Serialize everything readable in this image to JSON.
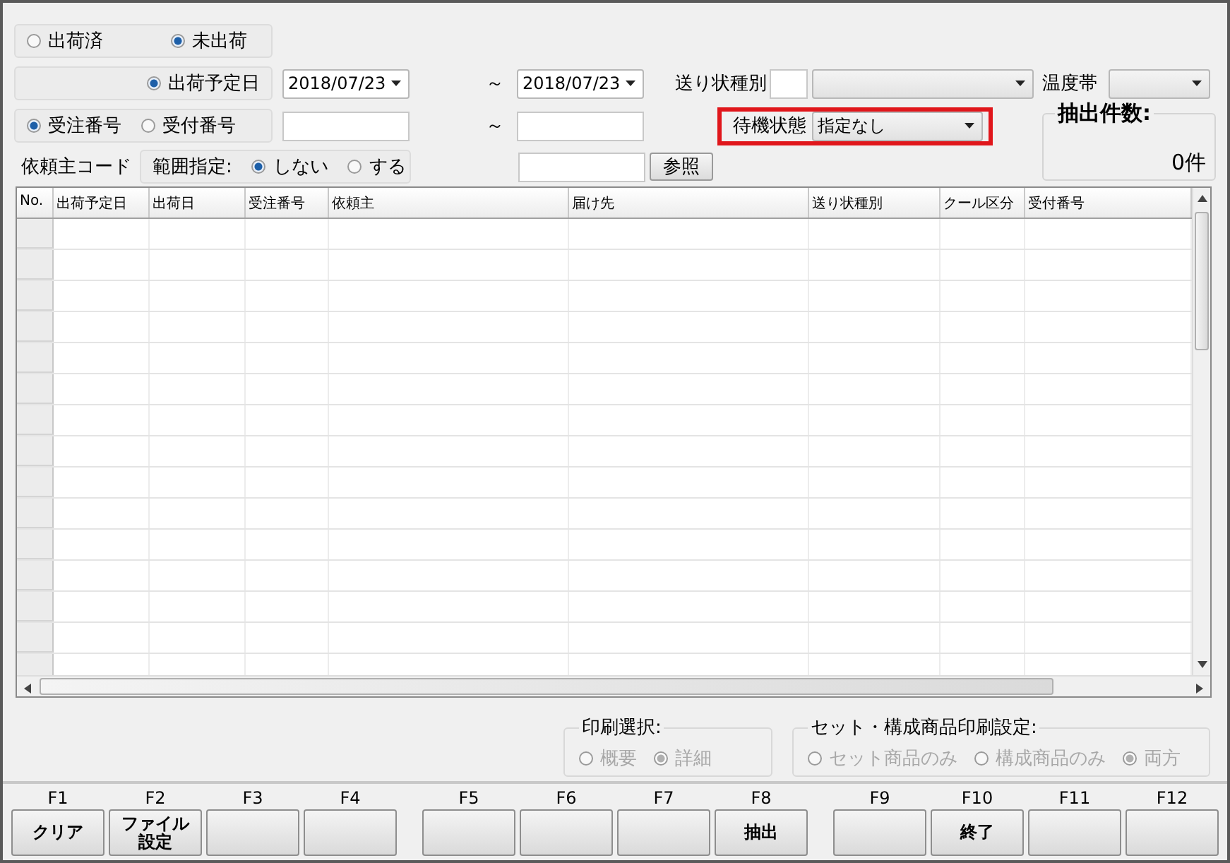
{
  "shipment_status": [
    {
      "label": "出荷済",
      "selected": false
    },
    {
      "label": "未出荷",
      "selected": true
    }
  ],
  "date_filter": {
    "label": "出荷予定日",
    "selected": true,
    "from": "2018/07/23",
    "tilde": "～",
    "to": "2018/07/23"
  },
  "number_filter": {
    "options": [
      {
        "label": "受注番号",
        "selected": true
      },
      {
        "label": "受付番号",
        "selected": false
      }
    ],
    "tilde": "～"
  },
  "invoice_type": {
    "label": "送り状種別"
  },
  "temperature": {
    "label": "温度帯"
  },
  "waiting_state": {
    "label": "待機状態",
    "value": "指定なし",
    "highlighted": true
  },
  "client_code": {
    "label": "依頼主コード",
    "range_label": "範囲指定:",
    "options": [
      {
        "label": "しない",
        "selected": true
      },
      {
        "label": "する",
        "selected": false
      }
    ],
    "browse_button": "参照"
  },
  "count": {
    "title": "抽出件数:",
    "value": "0件"
  },
  "table": {
    "columns": [
      "No.",
      "出荷予定日",
      "出荷日",
      "受注番号",
      "依頼主",
      "届け先",
      "送り状種別",
      "クール区分",
      "受付番号"
    ]
  },
  "print_selection": {
    "title": "印刷選択:",
    "disabled": true,
    "options": [
      {
        "label": "概要",
        "selected": false
      },
      {
        "label": "詳細",
        "selected": true
      }
    ]
  },
  "set_print": {
    "title": "セット・構成商品印刷設定:",
    "disabled": true,
    "options": [
      {
        "label": "セット商品のみ",
        "selected": false
      },
      {
        "label": "構成商品のみ",
        "selected": false
      },
      {
        "label": "両方",
        "selected": true
      }
    ]
  },
  "function_keys": [
    {
      "key": "F1",
      "label": "クリア"
    },
    {
      "key": "F2",
      "lines": [
        "ファイル",
        "設定"
      ]
    },
    {
      "key": "F3"
    },
    {
      "key": "F4"
    },
    {
      "key": "F5"
    },
    {
      "key": "F6"
    },
    {
      "key": "F7"
    },
    {
      "key": "F8",
      "label": "抽出"
    },
    {
      "key": "F9"
    },
    {
      "key": "F10",
      "label": "終了"
    },
    {
      "key": "F11"
    },
    {
      "key": "F12"
    }
  ]
}
